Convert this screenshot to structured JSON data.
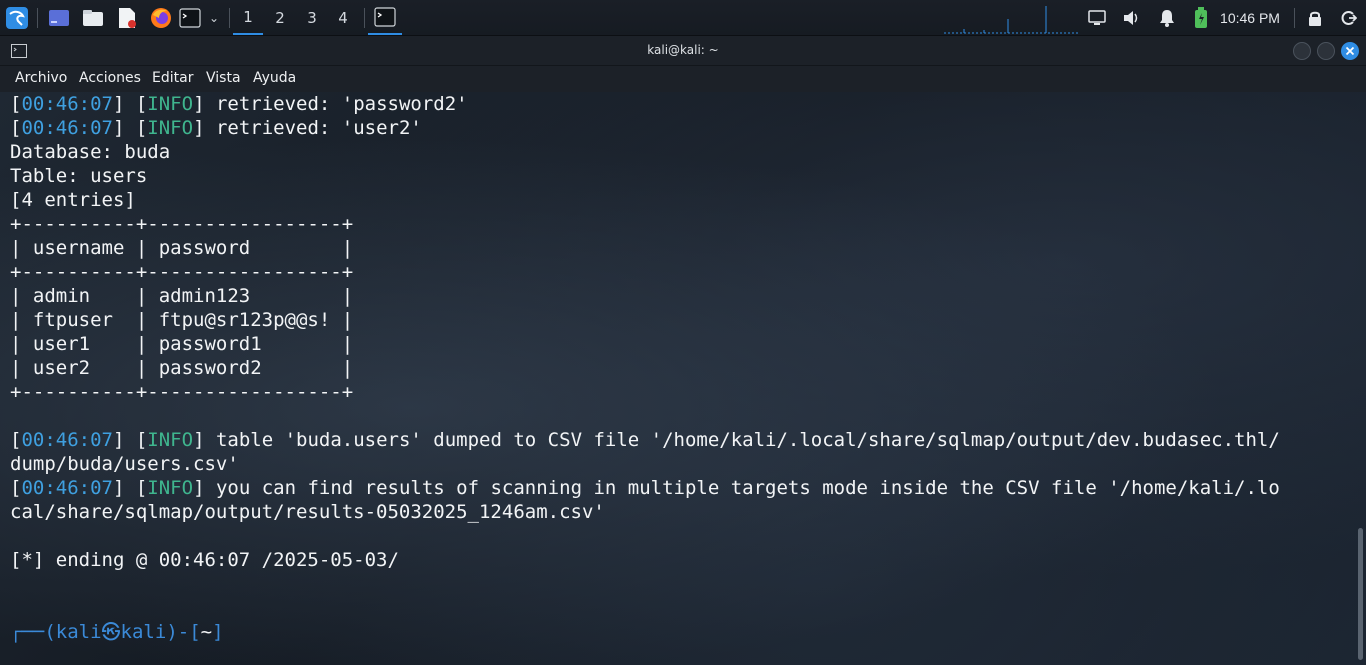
{
  "taskbar": {
    "workspaces": [
      "1",
      "2",
      "3",
      "4"
    ],
    "active_workspace": "1",
    "clock": "10:46 PM",
    "icons": [
      "kali-menu-icon",
      "desktop-icon",
      "file-manager-icon",
      "text-editor-icon",
      "firefox-icon",
      "terminal-icon",
      "chevron-down-icon",
      "terminal-task-icon",
      "monitor-icon",
      "volume-icon",
      "notifications-icon",
      "battery-icon",
      "lock-icon",
      "logout-icon"
    ]
  },
  "window": {
    "title": "kali@kali: ~",
    "menu": [
      "Archivo",
      "Acciones",
      "Editar",
      "Vista",
      "Ayuda"
    ]
  },
  "terminal": {
    "lines": [
      {
        "time": "00:46:07",
        "level": "INFO",
        "text": " retrieved: 'password2'"
      },
      {
        "time": "00:46:07",
        "level": "INFO",
        "text": " retrieved: 'user2'"
      },
      {
        "text": "Database: buda"
      },
      {
        "text": "Table: users"
      },
      {
        "text": "[4 entries]"
      },
      {
        "text": "+----------+-----------------+"
      },
      {
        "text": "| username | password        |"
      },
      {
        "text": "+----------+-----------------+"
      },
      {
        "text": "| admin    | admin123        |"
      },
      {
        "text": "| ftpuser  | ftpu@sr123p@@s! |"
      },
      {
        "text": "| user1    | password1       |"
      },
      {
        "text": "| user2    | password2       |"
      },
      {
        "text": "+----------+-----------------+"
      },
      {
        "text": ""
      },
      {
        "time": "00:46:07",
        "level": "INFO",
        "text": " table 'buda.users' dumped to CSV file '/home/kali/.local/share/sqlmap/output/dev.budasec.thl/"
      },
      {
        "text": "dump/buda/users.csv'"
      },
      {
        "time": "00:46:07",
        "level": "INFO",
        "text": " you can find results of scanning in multiple targets mode inside the CSV file '/home/kali/.lo"
      },
      {
        "text": "cal/share/sqlmap/output/results-05032025_1246am.csv'"
      },
      {
        "text": ""
      },
      {
        "text": "[*] ending @ 00:46:07 /2025-05-03/"
      },
      {
        "text": ""
      },
      {
        "text": ""
      }
    ],
    "prompt": {
      "prefix": "┌──(",
      "user": "kali",
      "at": "㉿",
      "host": "kali",
      "mid": ")-[",
      "path": "~",
      "suffix": "]"
    }
  }
}
